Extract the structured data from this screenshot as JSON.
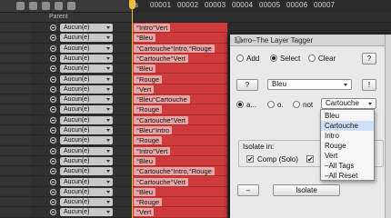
{
  "header": {
    "parent_label": "Parent"
  },
  "ruler": {
    "ticks": [
      "s",
      "00001",
      "00002",
      "00003",
      "00004",
      "00005",
      "00006",
      "00007"
    ]
  },
  "layers": [
    {
      "parent": "Aucun(e)",
      "tag": "°Intro°Vert"
    },
    {
      "parent": "Aucun(e)",
      "tag": "°Bleu"
    },
    {
      "parent": "Aucun(e)",
      "tag": "°Cartouche°Intro,°Rouge"
    },
    {
      "parent": "Aucun(e)",
      "tag": "°Cartouche°Vert"
    },
    {
      "parent": "Aucun(e)",
      "tag": "°Bleu"
    },
    {
      "parent": "Aucun(e)",
      "tag": "°Rouge"
    },
    {
      "parent": "Aucun(e)",
      "tag": "°Vert"
    },
    {
      "parent": "Aucun(e)",
      "tag": "°Bleu°Cartouche"
    },
    {
      "parent": "Aucun(e)",
      "tag": "°Rouge"
    },
    {
      "parent": "Aucun(e)",
      "tag": "°Cartouche°Vert"
    },
    {
      "parent": "Aucun(e)",
      "tag": "°Bleu°Intro"
    },
    {
      "parent": "Aucun(e)",
      "tag": "°Rouge"
    },
    {
      "parent": "Aucun(e)",
      "tag": "°Intro°Vert"
    },
    {
      "parent": "Aucun(e)",
      "tag": "°Bleu"
    },
    {
      "parent": "Aucun(e)",
      "tag": "°Cartouche°Intro,°Rouge"
    },
    {
      "parent": "Aucun(e)",
      "tag": "°Cartouche°Vert"
    },
    {
      "parent": "Aucun(e)",
      "tag": "°Bleu"
    },
    {
      "parent": "Aucun(e)",
      "tag": "°Rouge"
    },
    {
      "parent": "Aucun(e)",
      "tag": "°Vert"
    }
  ],
  "dialog": {
    "title": "Zorro–The Layer Tagger",
    "close_glyph": "x",
    "mode": {
      "options": [
        "Add",
        "Select",
        "Clear"
      ],
      "selected": "Select",
      "help_label": "?"
    },
    "tag_row": {
      "help_label": "?",
      "tag_value": "Bleu",
      "bang_label": "!"
    },
    "logic_row": {
      "options": [
        "a...",
        "o.",
        "not"
      ],
      "selected": "a...",
      "value": "Cartouche"
    },
    "isolate": {
      "label": "Isolate in:",
      "comp_label": "Comp (Solo)",
      "comp_checked": "✔",
      "second_checked": "✔"
    },
    "bottom": {
      "minus_label": "–",
      "isolate_label": "Isolate"
    }
  },
  "dropdown": {
    "items": [
      "Bleu",
      "Cartouche",
      "Intro",
      "Rouge",
      "Vert",
      "–All Tags",
      "–All Reset"
    ],
    "highlighted": "Cartouche"
  },
  "colors": {
    "layer_red": "#cf3b3b",
    "tag_fill": "#e7a6a6",
    "playhead": "#f0c23c",
    "highlight": "#cfe0f6"
  }
}
